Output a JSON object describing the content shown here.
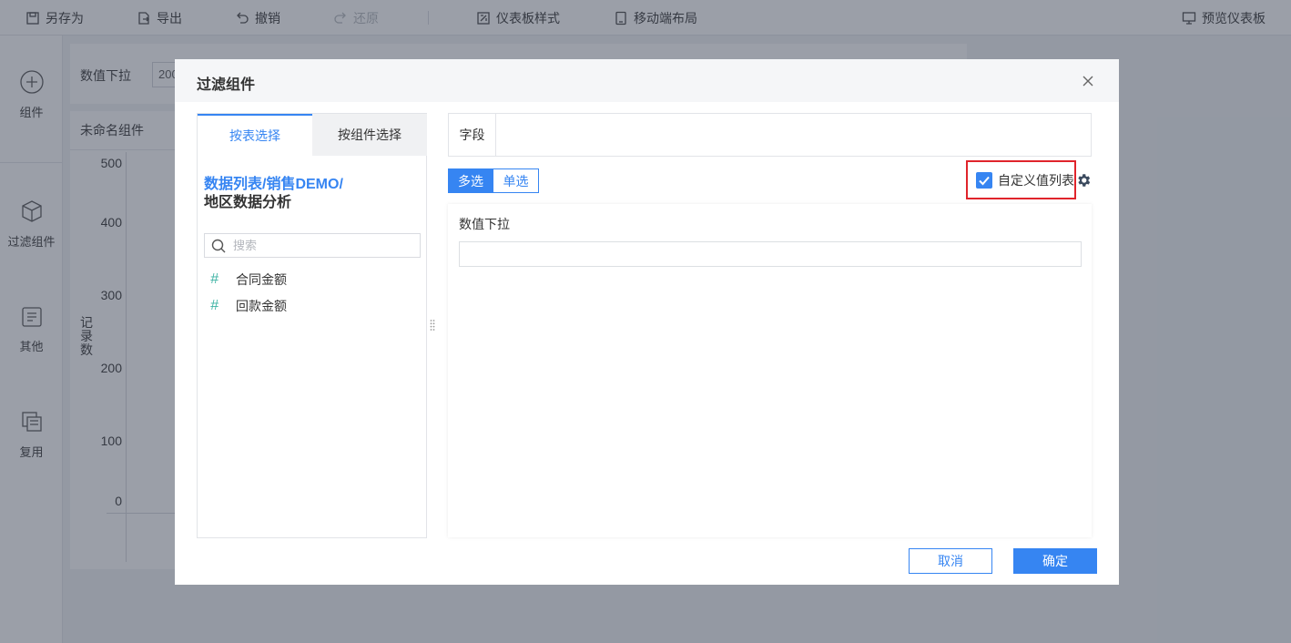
{
  "toolbar": {
    "save_as": "另存为",
    "export": "导出",
    "undo": "撤销",
    "redo": "还原",
    "dashboard_style": "仪表板样式",
    "mobile_layout": "移动端布局",
    "preview": "预览仪表板"
  },
  "sidebar": {
    "items": [
      {
        "label": "组件",
        "icon": "plus-circle-icon"
      },
      {
        "label": "过滤组件",
        "icon": "cube-icon"
      },
      {
        "label": "其他",
        "icon": "document-icon"
      },
      {
        "label": "复用",
        "icon": "copy-icon"
      }
    ]
  },
  "background": {
    "filter_label": "数值下拉",
    "filter_value": "200",
    "chart_title": "未命名组件",
    "y_axis_label": "记录数",
    "y_ticks": [
      "500",
      "400",
      "300",
      "200",
      "100",
      "0"
    ]
  },
  "dialog": {
    "title": "过滤组件",
    "tabs": [
      "按表选择",
      "按组件选择"
    ],
    "table_path_link": "数据列表/销售DEMO/",
    "table_path_name": "地区数据分析",
    "search_placeholder": "搜索",
    "fields": [
      "合同金额",
      "回款金额"
    ],
    "field_label": "字段",
    "multi_select": "多选",
    "single_select": "单选",
    "custom_value_list": "自定义值列表",
    "custom_value_checked": true,
    "preview_label": "数值下拉",
    "cancel": "取消",
    "confirm": "确定"
  },
  "colors": {
    "accent": "#3685f2",
    "highlight_border": "#e0242b",
    "field_hash": "#3eb3a4"
  }
}
